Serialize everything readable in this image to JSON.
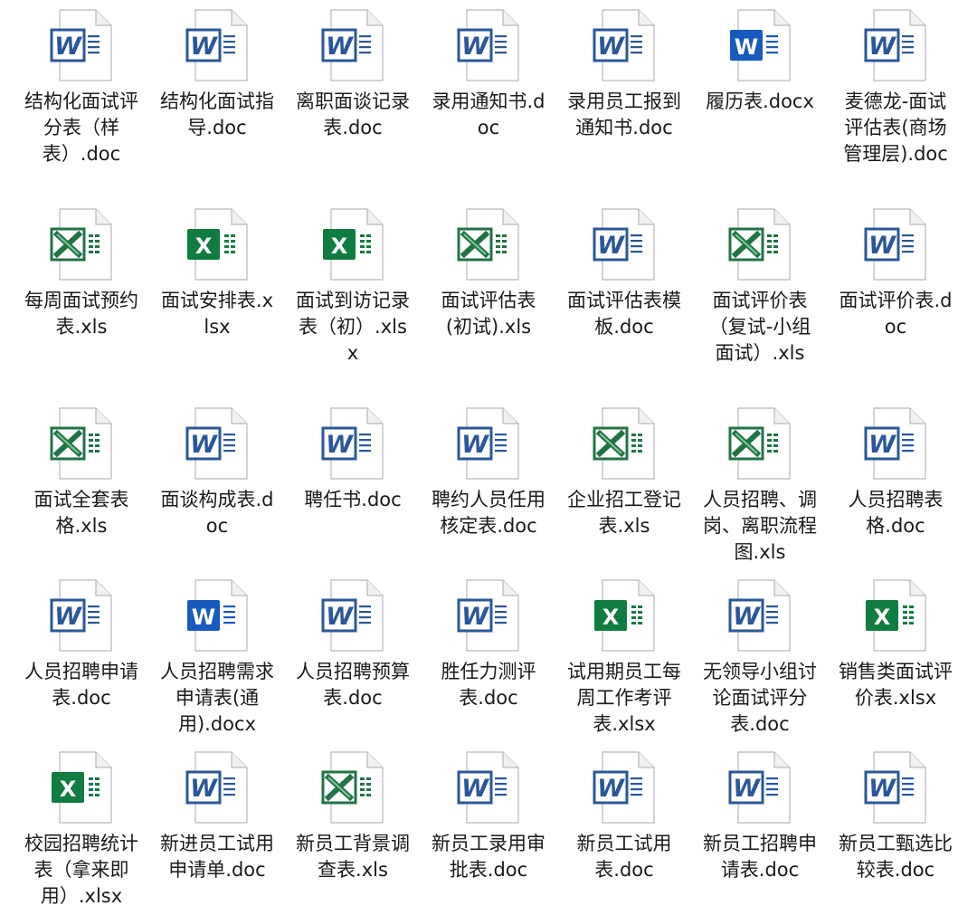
{
  "palette": {
    "word_blue": "#2b579a",
    "word_blue_solid": "#185abd",
    "excel_green": "#217346",
    "excel_green_solid": "#107c41",
    "page_border": "#b9b9b9",
    "label_text": "#1a1a1a"
  },
  "files": [
    {
      "name": "结构化面试评分表（样表）.doc",
      "icon": "word-icon"
    },
    {
      "name": "结构化面试指导.doc",
      "icon": "word-icon"
    },
    {
      "name": "离职面谈记录表.doc",
      "icon": "word-icon"
    },
    {
      "name": "录用通知书.doc",
      "icon": "word-icon"
    },
    {
      "name": "录用员工报到通知书.doc",
      "icon": "word-icon"
    },
    {
      "name": "履历表.docx",
      "icon": "word-docx-icon"
    },
    {
      "name": "麦德龙-面试评估表(商场管理层).doc",
      "icon": "word-icon"
    },
    {
      "name": "每周面试预约表.xls",
      "icon": "excel-icon"
    },
    {
      "name": "面试安排表.xlsx",
      "icon": "excel-xlsx-icon"
    },
    {
      "name": "面试到访记录表（初）.xlsx",
      "icon": "excel-xlsx-icon"
    },
    {
      "name": "面试评估表(初试).xls",
      "icon": "excel-icon"
    },
    {
      "name": "面试评估表模板.doc",
      "icon": "word-icon"
    },
    {
      "name": "面试评价表（复试-小组面试）.xls",
      "icon": "excel-icon"
    },
    {
      "name": "面试评价表.doc",
      "icon": "word-icon"
    },
    {
      "name": "面试全套表格.xls",
      "icon": "excel-icon"
    },
    {
      "name": "面谈构成表.doc",
      "icon": "word-icon"
    },
    {
      "name": "聘任书.doc",
      "icon": "word-icon"
    },
    {
      "name": "聘约人员任用核定表.doc",
      "icon": "word-icon"
    },
    {
      "name": "企业招工登记表.xls",
      "icon": "excel-icon"
    },
    {
      "name": "人员招聘、调岗、离职流程图.xls",
      "icon": "excel-icon"
    },
    {
      "name": "人员招聘表格.doc",
      "icon": "word-icon"
    },
    {
      "name": "人员招聘申请表.doc",
      "icon": "word-icon"
    },
    {
      "name": "人员招聘需求申请表(通用).docx",
      "icon": "word-docx-icon"
    },
    {
      "name": "人员招聘预算表.doc",
      "icon": "word-icon"
    },
    {
      "name": "胜任力测评表.doc",
      "icon": "word-icon"
    },
    {
      "name": "试用期员工每周工作考评表.xlsx",
      "icon": "excel-xlsx-icon"
    },
    {
      "name": "无领导小组讨论面试评分表.doc",
      "icon": "word-icon"
    },
    {
      "name": "销售类面试评价表.xlsx",
      "icon": "excel-xlsx-icon"
    },
    {
      "name": "校园招聘统计表（拿来即用）.xlsx",
      "icon": "excel-xlsx-icon"
    },
    {
      "name": "新进员工试用申请单.doc",
      "icon": "word-icon"
    },
    {
      "name": "新员工背景调查表.xls",
      "icon": "excel-icon"
    },
    {
      "name": "新员工录用审批表.doc",
      "icon": "word-icon"
    },
    {
      "name": "新员工试用表.doc",
      "icon": "word-icon"
    },
    {
      "name": "新员工招聘申请表.doc",
      "icon": "word-icon"
    },
    {
      "name": "新员工甄选比较表.doc",
      "icon": "word-icon"
    }
  ]
}
